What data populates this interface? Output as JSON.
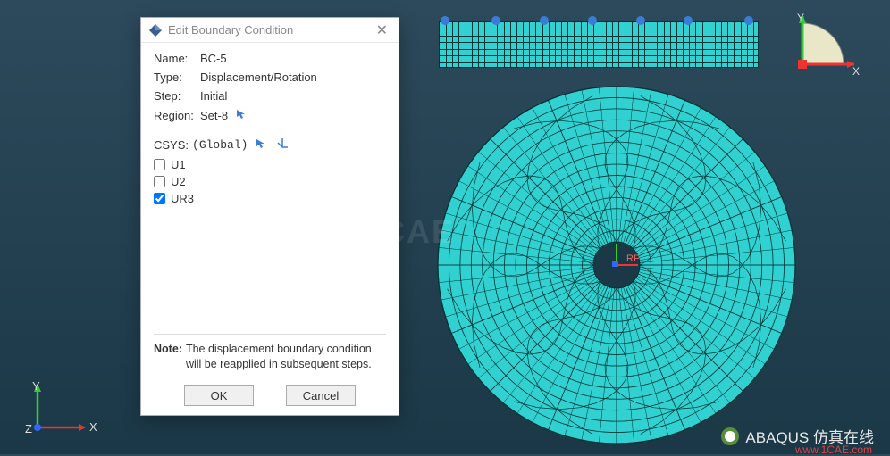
{
  "dialog": {
    "title": "Edit Boundary Condition",
    "fields": {
      "name_label": "Name:",
      "name_value": "BC-5",
      "type_label": "Type:",
      "type_value": "Displacement/Rotation",
      "step_label": "Step:",
      "step_value": "Initial",
      "region_label": "Region:",
      "region_value": "Set-8",
      "csys_label": "CSYS:",
      "csys_value": "(Global)"
    },
    "dofs": {
      "u1": "U1",
      "u2": "U2",
      "ur3": "UR3"
    },
    "note_label": "Note:",
    "note_text": "The displacement boundary condition will be reapplied in subsequent steps.",
    "ok": "OK",
    "cancel": "Cancel"
  },
  "triad": {
    "x": "X",
    "y": "Y",
    "z": "Z"
  },
  "watermark": "1CAE",
  "branding": {
    "text": "ABAQUS 仿真在线",
    "url": "www.1CAE.com"
  },
  "colors": {
    "mesh_fill": "#31d1d1",
    "mesh_line": "#003333",
    "bc": "#3a7dd8",
    "arrow_x": "#e33",
    "arrow_y": "#3c3",
    "arrow_z": "#36f"
  }
}
